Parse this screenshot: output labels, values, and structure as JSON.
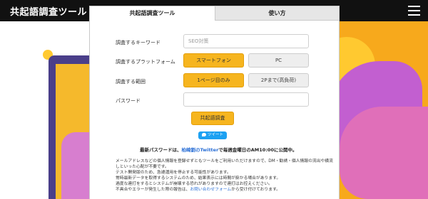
{
  "header": {
    "title": "共起語調査ツール",
    "menu_icon": "hamburger-menu-icon"
  },
  "tabs": [
    {
      "label": "共起語調査ツール",
      "active": true
    },
    {
      "label": "使い方",
      "active": false
    }
  ],
  "form": {
    "keyword": {
      "label": "調査するキーワード",
      "placeholder": "SEO対策",
      "value": ""
    },
    "platform": {
      "label": "調査するプラットフォーム",
      "options": [
        "スマートフォン",
        "PC"
      ],
      "selected": "スマートフォン"
    },
    "range": {
      "label": "調査する範囲",
      "options": [
        "1ページ目のみ",
        "2Pまで(高負荷)"
      ],
      "selected": "1ページ目のみ"
    },
    "password": {
      "label": "パスワード",
      "value": ""
    },
    "submit_label": "共起語調査"
  },
  "tweet": {
    "label": "ツイート",
    "icon": "twitter-bird-icon"
  },
  "notice": {
    "prefix": "最新パスワードは、",
    "link": "柏崎劉のTwitter",
    "suffix": "で毎週金曜日のAM10:00に公開中。"
  },
  "info": {
    "line1": "メールアドレスなどの個人情報を登録せずともツールをご利用いただけますので、DM・勧誘・個人情報の流出や横流",
    "line2": "しといった心配が不要です。",
    "line3": "テスト開発版のため、急遽運用を停止する可能性があります。",
    "line4": "常時最新データを取得するシステムのため、結果表示には時間が掛かる場合があります。",
    "line5": "過度な連打をするとシステムが崩壊する恐れがありますので連打はお控えください。",
    "line6_prefix": "不具合やエラーが発生した際の報告は、",
    "line6_link": "お問い合わせフォーム",
    "line6_suffix": "から受け付けております。"
  },
  "colors": {
    "header_bg": "#111111",
    "accent_orange": "#f6b51f",
    "inactive_tab": "#e6e6e6",
    "link_blue": "#2a6fd6",
    "twitter_blue": "#1da1f2",
    "bg_purple": "#c25fd0",
    "bg_orange": "#f7a91c"
  }
}
